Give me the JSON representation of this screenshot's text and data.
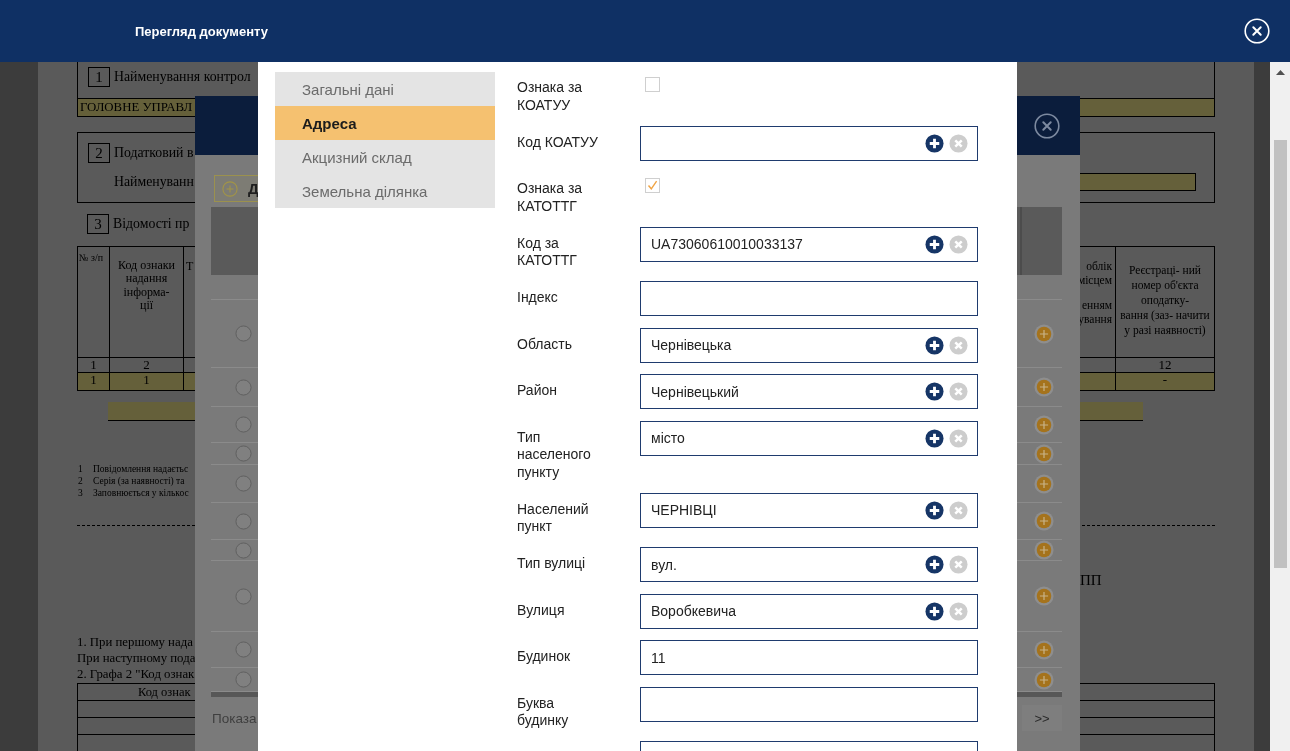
{
  "window": {
    "title": "Перегляд документу"
  },
  "document": {
    "box_1": {
      "number": "1",
      "title": "Найменування контрол",
      "value": "ГОЛОВНЕ УПРАВЛ"
    },
    "box_2": {
      "number": "2",
      "title": "Податковий в",
      "subtitle": "Найменуванн"
    },
    "section_3": {
      "number": "3",
      "title": "Відомості пр"
    },
    "table": {
      "column_1_header": "№ з/п",
      "column_2_header": [
        "Код ознаки",
        "надання",
        "інформа-",
        "ції"
      ],
      "column_3_header": "Т",
      "column_11_header": [
        "облік",
        "місцем",
        "енням",
        "ування"
      ],
      "column_12_header": [
        "Реєстраці- ний",
        "номер об'єкта",
        "оподатку-",
        "вання (заз- начити",
        "у разі наявності)"
      ],
      "number_row": {
        "column_1": "1",
        "column_2": "2",
        "column_12": "12"
      },
      "data_row": {
        "column_1": "1",
        "column_2": "1",
        "column_12": "-"
      }
    },
    "footnotes": [
      {
        "number": "1",
        "text": "Повідомлення надаєтьс"
      },
      {
        "number": "2",
        "text": "Серія (за наявності) та"
      },
      {
        "number": "3",
        "text": "Заповнюється у кількос"
      }
    ],
    "fragment": "ПП",
    "notes": [
      "1. При першому нада",
      "При наступному пода",
      "2. Графа 2 \"Код ознак"
    ],
    "code_table": {
      "header": "Код ознак"
    }
  },
  "list_dialog": {
    "add_button": "Д",
    "rows": [
      {
        "selected": false
      },
      {
        "selected": false
      },
      {
        "selected": false
      },
      {
        "selected": false
      },
      {
        "selected": false
      },
      {
        "selected": false
      },
      {
        "selected": false
      },
      {
        "selected": false
      },
      {
        "selected": false
      },
      {
        "selected": false
      }
    ],
    "footer_text": "Показа",
    "next_page": ">>"
  },
  "edit_dialog": {
    "tabs": [
      {
        "label": "Загальні дані",
        "selected": false
      },
      {
        "label": "Адреса",
        "selected": true
      },
      {
        "label": "Акцизний склад",
        "selected": false
      },
      {
        "label": "Земельна ділянка",
        "selected": false
      }
    ],
    "fields": [
      {
        "kind": "checkbox",
        "label": "Ознака за КОАТУУ",
        "checked": false
      },
      {
        "kind": "lookup",
        "label": "Код КОАТУУ"
      },
      {
        "kind": "checkbox",
        "label": "Ознака за КАТОТТГ",
        "checked": true
      },
      {
        "kind": "lookup",
        "label": "Код за КАТОТТГ",
        "value": "UA73060610010033137"
      },
      {
        "kind": "text",
        "label": "Індекс"
      },
      {
        "kind": "lookup",
        "label": "Область",
        "value": "Чернівецька"
      },
      {
        "kind": "lookup",
        "label": "Район",
        "value": "Чернівецький"
      },
      {
        "kind": "lookup",
        "label": "Тип населеного пункту",
        "value": "місто"
      },
      {
        "kind": "lookup",
        "label": "Населений пункт",
        "value": "ЧЕРНІВЦІ"
      },
      {
        "kind": "lookup",
        "label": "Тип вулиці",
        "value": "вул."
      },
      {
        "kind": "lookup",
        "label": "Вулиця",
        "value": "Воробкевича"
      },
      {
        "kind": "text",
        "label": "Будинок",
        "value": "11"
      },
      {
        "kind": "text",
        "label": "Буква будинку"
      },
      {
        "kind": "text"
      }
    ]
  }
}
